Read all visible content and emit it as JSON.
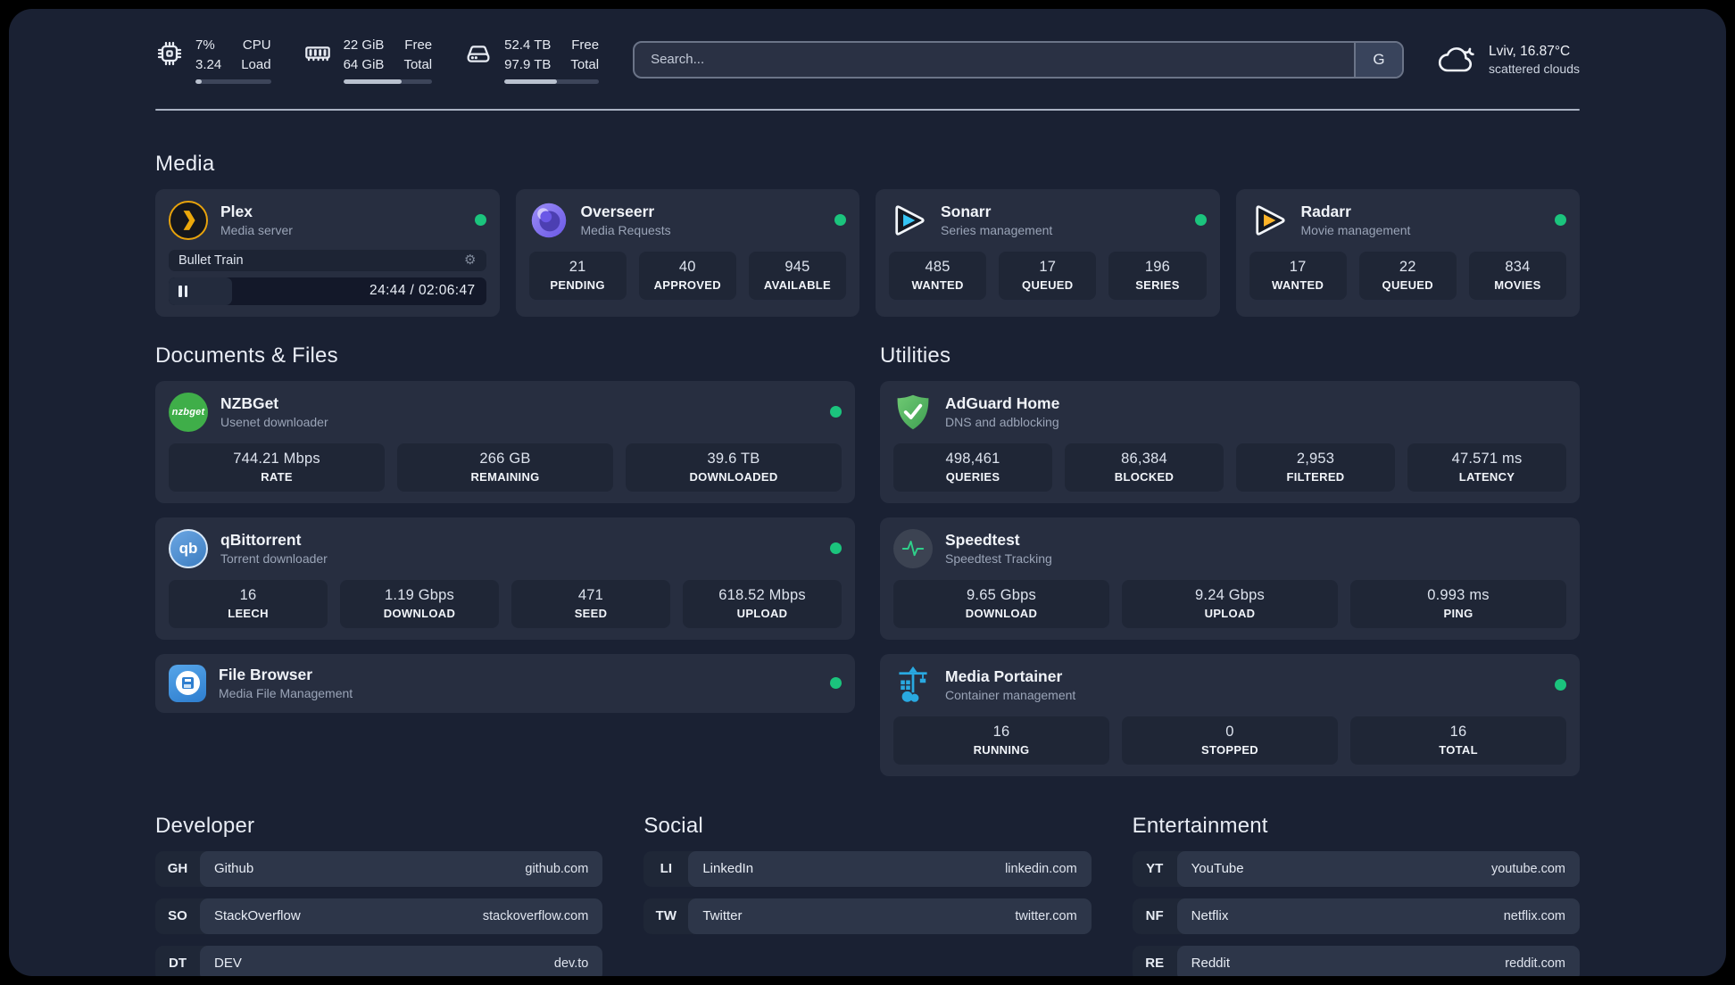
{
  "header": {
    "cpu": {
      "top_value": "7%",
      "bottom_value": "3.24",
      "top_label": "CPU",
      "bottom_label": "Load",
      "progress": 8
    },
    "ram": {
      "top_value": "22 GiB",
      "bottom_value": "64 GiB",
      "top_label": "Free",
      "bottom_label": "Total",
      "progress": 66
    },
    "disk": {
      "top_value": "52.4 TB",
      "bottom_value": "97.9 TB",
      "top_label": "Free",
      "bottom_label": "Total",
      "progress": 56
    },
    "search": {
      "placeholder": "Search...",
      "button": "G"
    },
    "weather": {
      "location": "Lviv, 16.87°C",
      "condition": "scattered clouds"
    }
  },
  "sections": {
    "media": "Media",
    "documents": "Documents & Files",
    "utilities": "Utilities",
    "developer": "Developer",
    "social": "Social",
    "entertainment": "Entertainment"
  },
  "icons": {
    "gear": "⚙"
  },
  "apps": {
    "plex": {
      "name": "Plex",
      "subtitle": "Media server",
      "player": {
        "title": "Bullet Train",
        "time": "24:44 / 02:06:47",
        "progress": 20
      }
    },
    "overseerr": {
      "name": "Overseerr",
      "subtitle": "Media Requests",
      "stats": [
        {
          "value": "21",
          "label": "PENDING"
        },
        {
          "value": "40",
          "label": "APPROVED"
        },
        {
          "value": "945",
          "label": "AVAILABLE"
        }
      ]
    },
    "sonarr": {
      "name": "Sonarr",
      "subtitle": "Series management",
      "stats": [
        {
          "value": "485",
          "label": "WANTED"
        },
        {
          "value": "17",
          "label": "QUEUED"
        },
        {
          "value": "196",
          "label": "SERIES"
        }
      ]
    },
    "radarr": {
      "name": "Radarr",
      "subtitle": "Movie management",
      "stats": [
        {
          "value": "17",
          "label": "WANTED"
        },
        {
          "value": "22",
          "label": "QUEUED"
        },
        {
          "value": "834",
          "label": "MOVIES"
        }
      ]
    },
    "nzbget": {
      "name": "NZBGet",
      "subtitle": "Usenet downloader",
      "icon_text": "nzbget",
      "stats": [
        {
          "value": "744.21 Mbps",
          "label": "RATE"
        },
        {
          "value": "266 GB",
          "label": "REMAINING"
        },
        {
          "value": "39.6 TB",
          "label": "DOWNLOADED"
        }
      ]
    },
    "qbittorrent": {
      "name": "qBittorrent",
      "subtitle": "Torrent downloader",
      "icon_text": "qb",
      "stats": [
        {
          "value": "16",
          "label": "LEECH"
        },
        {
          "value": "1.19 Gbps",
          "label": "DOWNLOAD"
        },
        {
          "value": "471",
          "label": "SEED"
        },
        {
          "value": "618.52 Mbps",
          "label": "UPLOAD"
        }
      ]
    },
    "filebrowser": {
      "name": "File Browser",
      "subtitle": "Media File Management"
    },
    "adguard": {
      "name": "AdGuard Home",
      "subtitle": "DNS and adblocking",
      "stats": [
        {
          "value": "498,461",
          "label": "QUERIES"
        },
        {
          "value": "86,384",
          "label": "BLOCKED"
        },
        {
          "value": "2,953",
          "label": "FILTERED"
        },
        {
          "value": "47.571 ms",
          "label": "LATENCY"
        }
      ]
    },
    "speedtest": {
      "name": "Speedtest",
      "subtitle": "Speedtest Tracking",
      "stats": [
        {
          "value": "9.65 Gbps",
          "label": "DOWNLOAD"
        },
        {
          "value": "9.24 Gbps",
          "label": "UPLOAD"
        },
        {
          "value": "0.993 ms",
          "label": "PING"
        }
      ]
    },
    "portainer": {
      "name": "Media Portainer",
      "subtitle": "Container management",
      "stats": [
        {
          "value": "16",
          "label": "RUNNING"
        },
        {
          "value": "0",
          "label": "STOPPED"
        },
        {
          "value": "16",
          "label": "TOTAL"
        }
      ]
    }
  },
  "links": {
    "developer": [
      {
        "abbr": "GH",
        "name": "Github",
        "url": "github.com"
      },
      {
        "abbr": "SO",
        "name": "StackOverflow",
        "url": "stackoverflow.com"
      },
      {
        "abbr": "DT",
        "name": "DEV",
        "url": "dev.to"
      }
    ],
    "social": [
      {
        "abbr": "LI",
        "name": "LinkedIn",
        "url": "linkedin.com"
      },
      {
        "abbr": "TW",
        "name": "Twitter",
        "url": "twitter.com"
      }
    ],
    "entertainment": [
      {
        "abbr": "YT",
        "name": "YouTube",
        "url": "youtube.com"
      },
      {
        "abbr": "NF",
        "name": "Netflix",
        "url": "netflix.com"
      },
      {
        "abbr": "RE",
        "name": "Reddit",
        "url": "reddit.com"
      }
    ]
  },
  "colors": {
    "status_online": "#1bc47d",
    "accent_plex": "#e8a30c",
    "accent_sonarr": "#35c5f4",
    "accent_radarr": "#ffb529"
  }
}
